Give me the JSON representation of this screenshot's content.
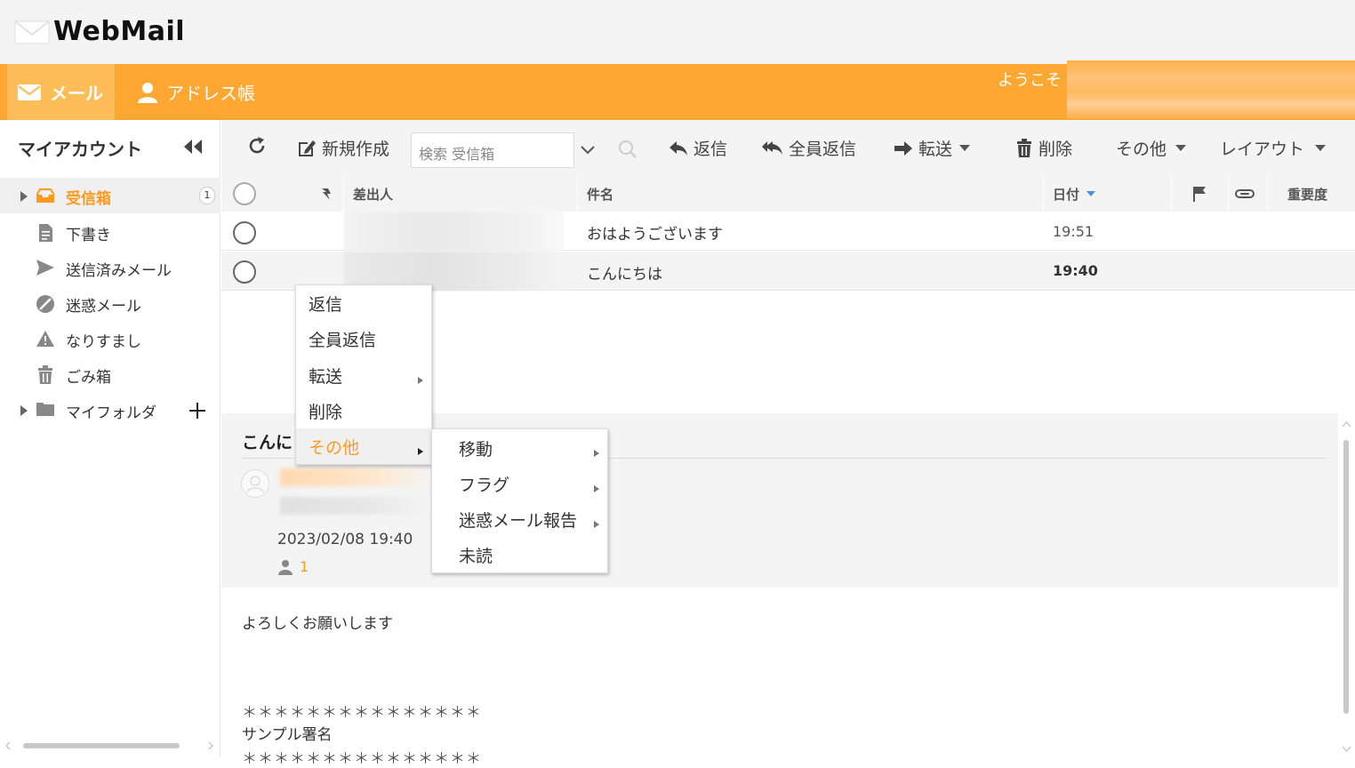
{
  "app": {
    "logo_text": "WebMail"
  },
  "nav": {
    "mail_label": "メール",
    "address_label": "アドレス帳",
    "welcome_text": "ようこそ"
  },
  "sidebar": {
    "title": "マイアカウント",
    "folders": [
      {
        "label": "受信箱",
        "badge": "1",
        "icon": "inbox-icon"
      },
      {
        "label": "下書き",
        "icon": "draft-icon"
      },
      {
        "label": "送信済みメール",
        "icon": "send-icon"
      },
      {
        "label": "迷惑メール",
        "icon": "spam-icon"
      },
      {
        "label": "なりすまし",
        "icon": "warning-icon"
      },
      {
        "label": "ごみ箱",
        "icon": "trash-icon"
      },
      {
        "label": "マイフォルダ",
        "icon": "folder-icon"
      }
    ]
  },
  "toolbar": {
    "compose": "新規作成",
    "search_placeholder": "検索 受信箱",
    "reply": "返信",
    "reply_all": "全員返信",
    "forward": "転送",
    "delete": "削除",
    "more": "その他",
    "layout": "レイアウト"
  },
  "list": {
    "headers": {
      "from": "差出人",
      "subject": "件名",
      "date": "日付",
      "importance": "重要度"
    },
    "rows": [
      {
        "subject": "おはようございます",
        "date": "19:51",
        "unread": false
      },
      {
        "subject": "こんにちは",
        "date": "19:40",
        "unread": true
      }
    ]
  },
  "preview": {
    "subject": "こんに",
    "date": "2023/02/08 19:40",
    "recipient_count": "1",
    "body_lines": [
      "よろしくお願いします",
      "＊＊＊＊＊＊＊＊＊＊＊＊＊＊＊",
      "サンプル署名",
      "＊＊＊＊＊＊＊＊＊＊＊＊＊＊＊"
    ]
  },
  "context_menu": {
    "items": [
      "返信",
      "全員返信",
      "転送",
      "削除",
      "その他"
    ]
  },
  "submenu": {
    "items": [
      "移動",
      "フラグ",
      "迷惑メール報告",
      "未読"
    ]
  },
  "colors": {
    "accent": "#ffa733",
    "accent_text": "#ff9a1f"
  }
}
